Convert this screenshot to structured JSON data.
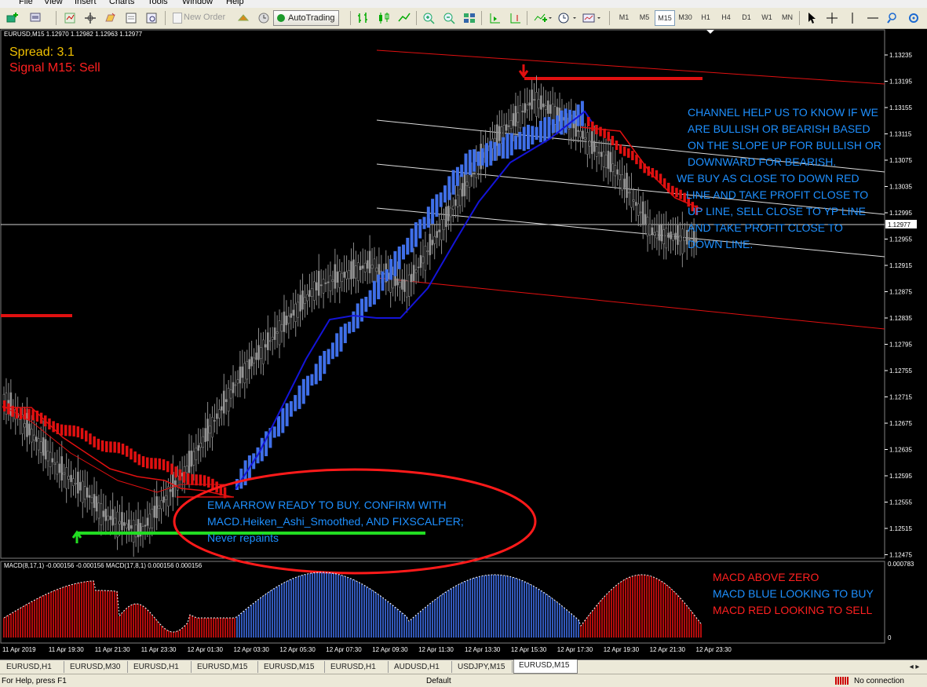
{
  "menu": [
    "File",
    "View",
    "Insert",
    "Charts",
    "Tools",
    "Window",
    "Help"
  ],
  "toolbar": {
    "new_order": "New Order",
    "autotrading": "AutoTrading",
    "timeframes": [
      "M1",
      "M5",
      "M15",
      "M30",
      "H1",
      "H4",
      "D1",
      "W1",
      "MN"
    ],
    "active_timeframe": "M15",
    "icons": [
      "new-chart-icon",
      "profiles-icon",
      "market-watch-icon",
      "navigator-icon",
      "terminal-icon",
      "strategy-tester-icon",
      "new-order-icon",
      "metaeditor-icon",
      "bar-chart-icon",
      "candlestick-icon",
      "line-chart-icon",
      "zoom-in-icon",
      "zoom-out-icon",
      "tile-icon",
      "autoscroll-icon",
      "chart-shift-icon",
      "indicators-icon",
      "periods-icon",
      "templates-icon",
      "cursor-icon",
      "crosshair-icon",
      "search-icon",
      "settings-icon"
    ]
  },
  "chart": {
    "title": "EURUSD,M15  1.12970 1.12982 1.12963 1.12977",
    "spread": "Spread: 3.1",
    "signal": "Signal M15: Sell",
    "current_price": "1.12977",
    "price_labels": [
      "1.13235",
      "1.13195",
      "1.13155",
      "1.13115",
      "1.13075",
      "1.13035",
      "1.12995",
      "1.12955",
      "1.12915",
      "1.12875",
      "1.12835",
      "1.12795",
      "1.12755",
      "1.12715",
      "1.12675",
      "1.12635",
      "1.12595",
      "1.12555",
      "1.12515",
      "1.12475"
    ],
    "note_channel": [
      "CHANNEL HELP US TO KNOW IF WE",
      "ARE BULLISH OR BEARISH BASED",
      "ON THE SLOPE UP FOR BULLISH OR",
      "DOWNWARD FOR BEARISH."
    ],
    "note_buy": [
      "WE BUY AS CLOSE TO DOWN  RED",
      "LINE AND TAKE PROFIT CLOSE TO",
      "UP LINE, SELL CLOSE TO YP LINE",
      "AND TAKE PROFIT CLOSE TO",
      "DOWN LINE."
    ],
    "note_ema": [
      "EMA ARROW READY TO BUY. CONFIRM WITH",
      "MACD.Heiken_Ashi_Smoothed, AND FIXSCALPER;",
      "Never repaints"
    ]
  },
  "macd": {
    "title": "MACD(8,17,1) -0.000156 -0.000156  MACD(17,8,1) 0.000156 0.000156",
    "top_label": "0.000783",
    "zero_label": "0",
    "notes": [
      "MACD ABOVE ZERO",
      "MACD BLUE LOOKING TO BUY",
      "MACD RED LOOKING TO SELL"
    ]
  },
  "time_labels": [
    "11 Apr 2019",
    "11 Apr 19:30",
    "11 Apr 21:30",
    "11 Apr 23:30",
    "12 Apr 01:30",
    "12 Apr 03:30",
    "12 Apr 05:30",
    "12 Apr 07:30",
    "12 Apr 09:30",
    "12 Apr 11:30",
    "12 Apr 13:30",
    "12 Apr 15:30",
    "12 Apr 17:30",
    "12 Apr 19:30",
    "12 Apr 21:30",
    "12 Apr 23:30"
  ],
  "tabs": [
    "EURUSD,H1",
    "EURUSD,M30",
    "EURUSD,H1",
    "EURUSD,M15",
    "EURUSD,M15",
    "EURUSD,H1",
    "AUDUSD,H1",
    "USDJPY,M15",
    "EURUSD,M15"
  ],
  "active_tab_index": 8,
  "status": {
    "help": "For Help, press F1",
    "profile": "Default",
    "connection": "No connection"
  },
  "colors": {
    "bg": "#000000",
    "bull": "#3f6fe8",
    "bear": "#e01010",
    "ema_buy": "#22dd22",
    "note_blue": "#1e90ff",
    "annot_red": "#ff1a1a"
  }
}
